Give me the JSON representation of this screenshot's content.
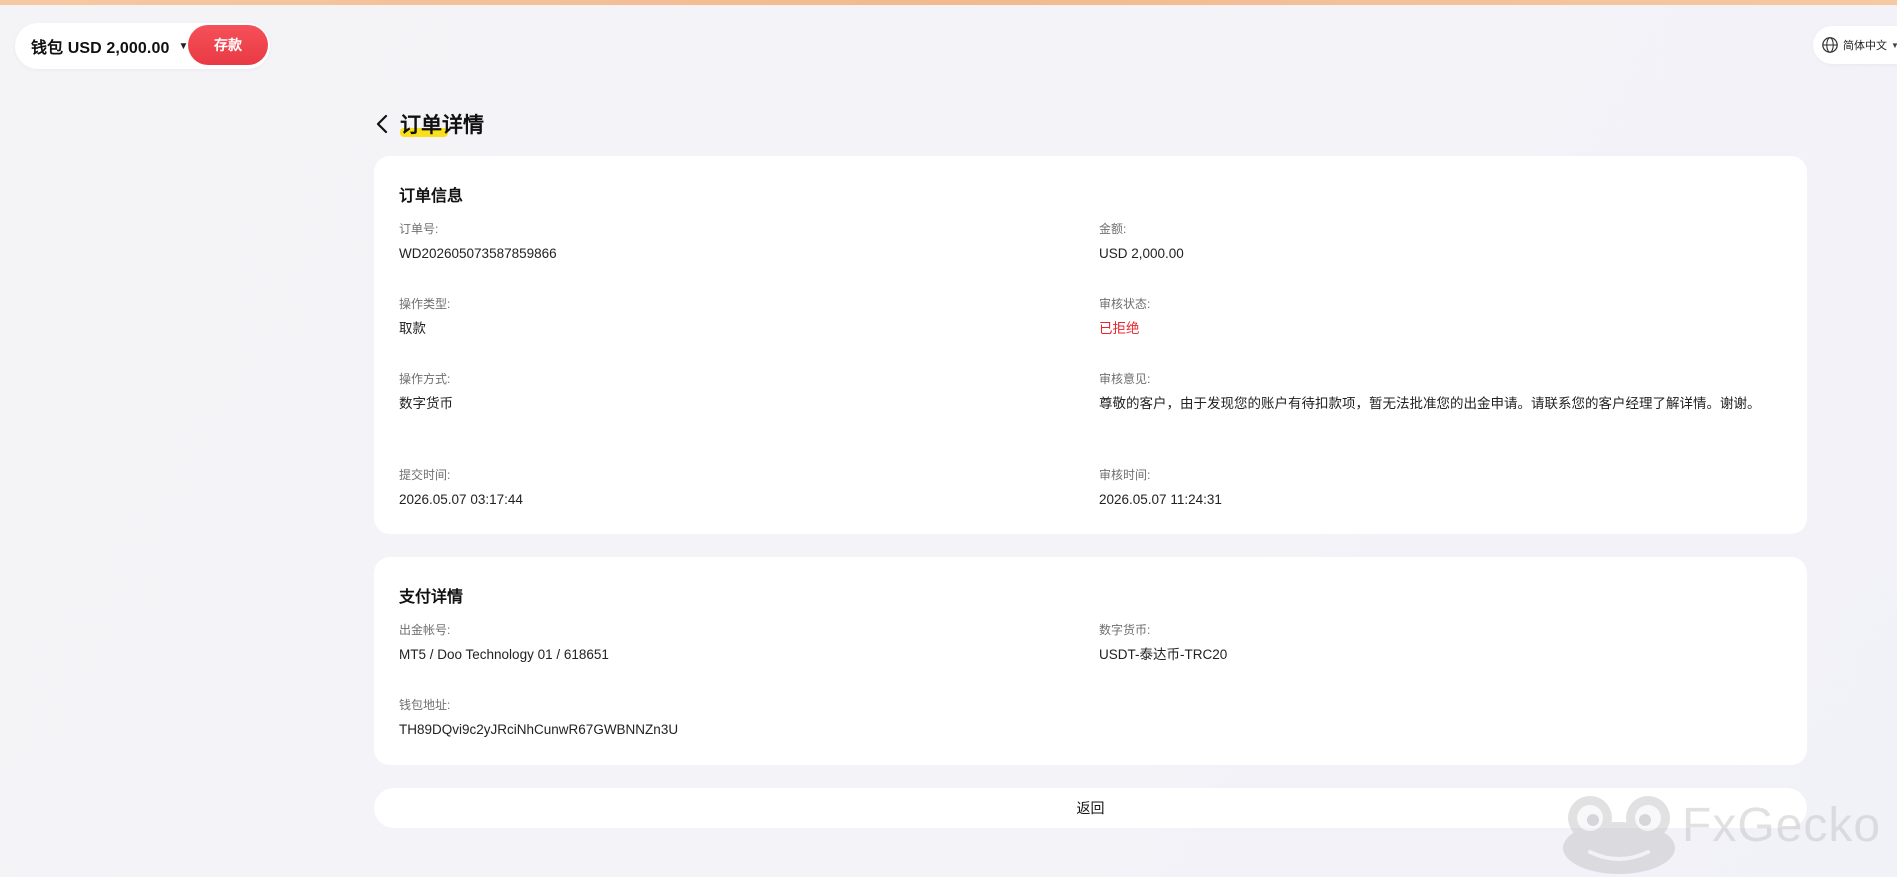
{
  "colors": {
    "accent_red": "#e83a44",
    "rejected_status": "#e5272f",
    "title_highlight": "#f9e01a"
  },
  "topbar": {
    "wallet_label": "钱包 USD 2,000.00",
    "wallet_caret_icon": "caret-down-icon",
    "deposit_label": "存款",
    "language_icon": "globe-icon",
    "language_label": "简体中文"
  },
  "header": {
    "back_icon": "chevron-left-icon",
    "title": "订单详情"
  },
  "order_info": {
    "title": "订单信息",
    "order_no_label": "订单号:",
    "order_no_value": "WD202605073587859866",
    "amount_label": "金额:",
    "amount_value": "USD 2,000.00",
    "op_type_label": "操作类型:",
    "op_type_value": "取款",
    "review_status_label": "审核状态:",
    "review_status_value": "已拒绝",
    "op_method_label": "操作方式:",
    "op_method_value": "数字货币",
    "review_comment_label": "审核意见:",
    "review_comment_value": "尊敬的客户，由于发现您的账户有待扣款项，暂无法批准您的出金申请。请联系您的客户经理了解详情。谢谢。",
    "submit_time_label": "提交时间:",
    "submit_time_value": "2026.05.07 03:17:44",
    "review_time_label": "审核时间:",
    "review_time_value": "2026.05.07 11:24:31"
  },
  "payment_details": {
    "title": "支付详情",
    "account_label": "出金帐号:",
    "account_value": "MT5 / Doo Technology 01 / 618651",
    "currency_label": "数字货币:",
    "currency_value": "USDT-泰达币-TRC20",
    "wallet_address_label": "钱包地址:",
    "wallet_address_value": "TH89DQvi9c2yJRciNhCunwR67GWBNNZn3U"
  },
  "footer": {
    "return_label": "返回"
  },
  "watermark": {
    "text": "FxGecko",
    "icon": "frog-logo-icon"
  }
}
